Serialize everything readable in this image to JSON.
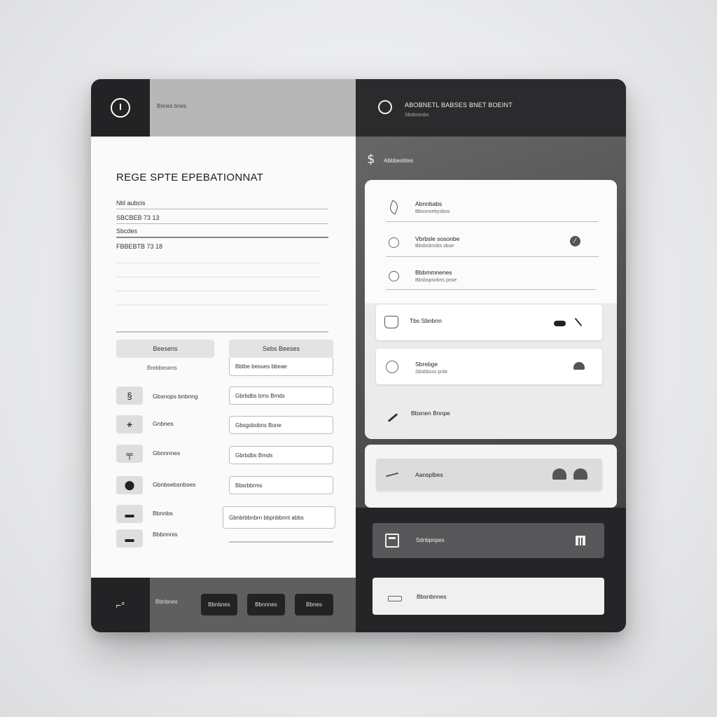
{
  "left_header": {
    "text": "Bnnes bnes"
  },
  "page_title": "REGE SPTE EPEBATIONNAT",
  "fields": [
    {
      "label": "Ntil aubcis"
    },
    {
      "label": "SBCBEB  73  13"
    },
    {
      "label": "Sbcdes"
    },
    {
      "label": "FBBEBTB  73  18"
    }
  ],
  "tabs": {
    "left": "Beesens",
    "left_sub": "Brebbesens",
    "right": "Sebs  Beeses"
  },
  "selects": [
    "Bbtbe beoues bbeae",
    "Gbrbdbs bms Bmds",
    "Gbsgsbobns Bone",
    "Gbrbdbs Bmds",
    "Bbsrbbrms",
    "Gbnbrbbnbrn bbpnbbnnt abbs"
  ],
  "list_items": [
    {
      "glyph": "§",
      "label": "Gbsnops bnbnng"
    },
    {
      "glyph": "⚹",
      "label": "Gnbnes"
    },
    {
      "glyph": "╤",
      "label": "Gbnnnnes"
    },
    {
      "glyph": "⬤",
      "label": "Gbnbsebsnbses"
    },
    {
      "glyph": "▬",
      "label": "Bbnnbs"
    },
    {
      "glyph": "▬",
      "label": "Bbbnnnis"
    }
  ],
  "footer": {
    "icon": "⌐°",
    "label": "Bbnbnes",
    "buttons": [
      "Bbnbnes",
      "Bbnnnes",
      "Bbnes"
    ]
  },
  "right_header": {
    "title": "ABOBNETL BABSES BNET BOEINT",
    "subtitle": "Sbsbosnbs"
  },
  "right_sub": "Abbbesbtes",
  "rows": [
    {
      "title": "Abnnbabs",
      "sub": "Bbsonsebysbos"
    },
    {
      "title": "Vbrbsle sosonbe",
      "sub": "Bbsbsbnsbs sbue"
    },
    {
      "title": "Bbbmmnenes",
      "sub": "Bbsbspsnbns pnse"
    }
  ],
  "cards": [
    {
      "title": "Tbs Sbnbnn"
    },
    {
      "title": "Sbrebge",
      "sub": "Sbsbbsss pnbr"
    }
  ],
  "edit_row": {
    "label": "Bbsnen Bnnpe"
  },
  "pill_row": {
    "label": "Aansplbes"
  },
  "dark_button": {
    "label": "Sdnbpnpes"
  },
  "light_button": {
    "label": "Bbsnbnnes"
  }
}
